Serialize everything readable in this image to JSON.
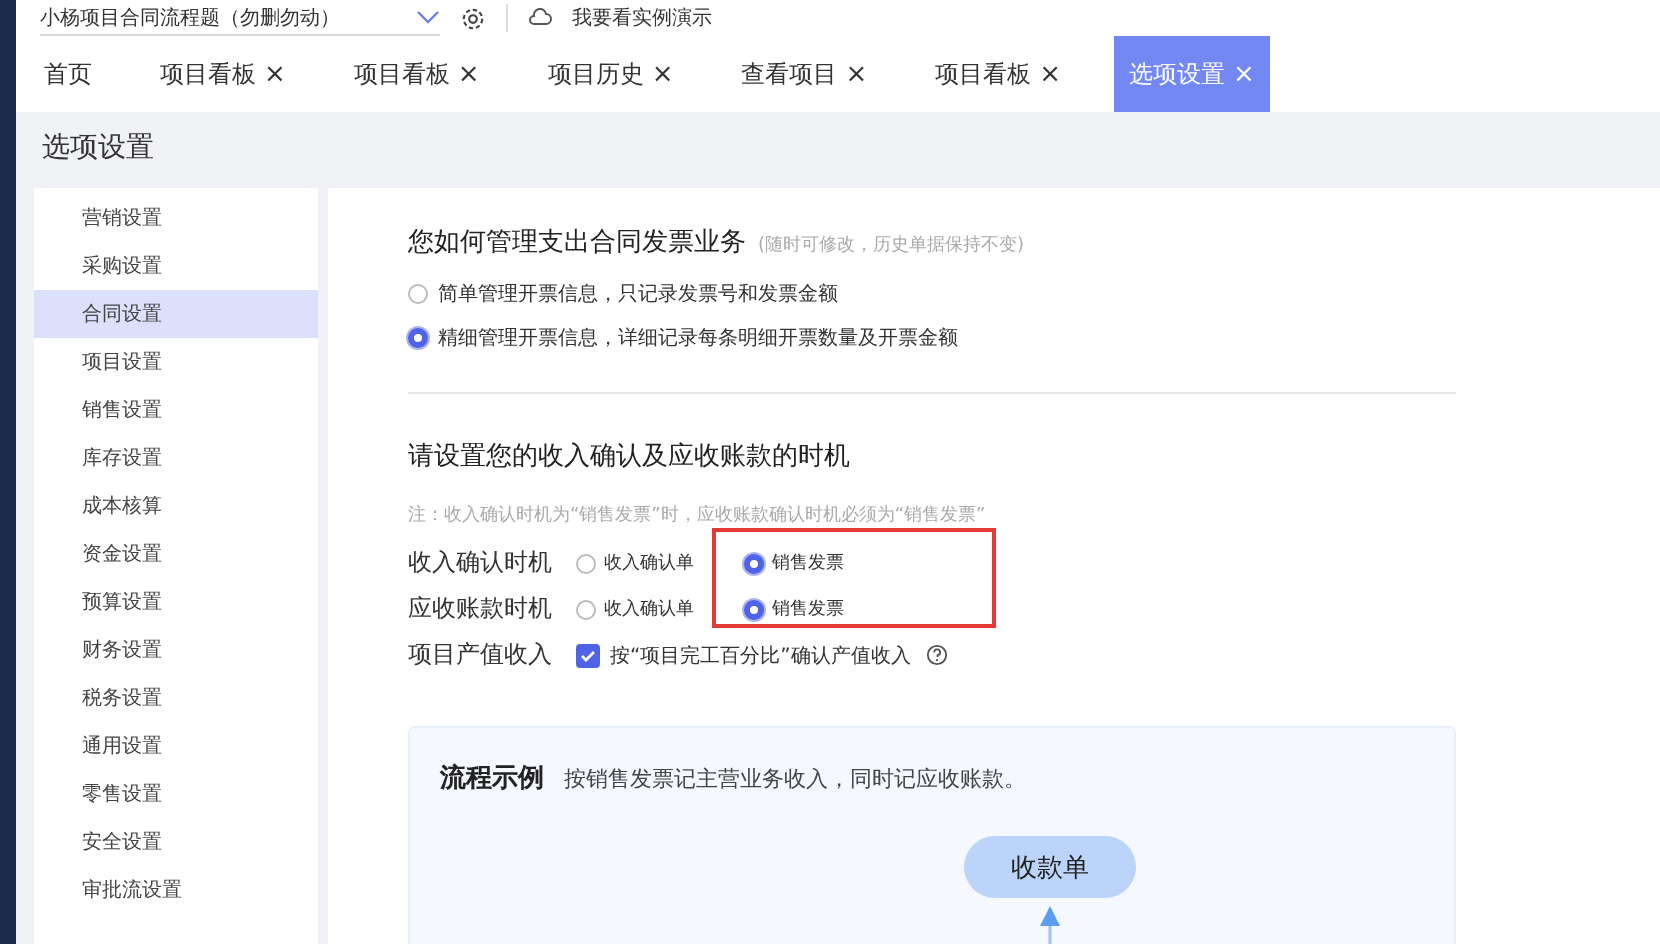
{
  "header": {
    "project": "小杨项目合同流程题（勿删勿动）",
    "demo_link": "我要看实例演示"
  },
  "tabs": [
    {
      "label": "首页",
      "closable": false,
      "selected": false
    },
    {
      "label": "项目看板",
      "closable": true,
      "selected": false
    },
    {
      "label": "项目看板",
      "closable": true,
      "selected": false
    },
    {
      "label": "项目历史",
      "closable": true,
      "selected": false
    },
    {
      "label": "查看项目",
      "closable": true,
      "selected": false
    },
    {
      "label": "项目看板",
      "closable": true,
      "selected": false
    },
    {
      "label": "选项设置",
      "closable": true,
      "selected": true
    }
  ],
  "close_glyph": "×",
  "page_title": "选项设置",
  "sidebar": {
    "items": [
      {
        "label": "营销设置",
        "selected": false
      },
      {
        "label": "采购设置",
        "selected": false
      },
      {
        "label": "合同设置",
        "selected": true
      },
      {
        "label": "项目设置",
        "selected": false
      },
      {
        "label": "销售设置",
        "selected": false
      },
      {
        "label": "库存设置",
        "selected": false
      },
      {
        "label": "成本核算",
        "selected": false
      },
      {
        "label": "资金设置",
        "selected": false
      },
      {
        "label": "预算设置",
        "selected": false
      },
      {
        "label": "财务设置",
        "selected": false
      },
      {
        "label": "税务设置",
        "selected": false
      },
      {
        "label": "通用设置",
        "selected": false
      },
      {
        "label": "零售设置",
        "selected": false
      },
      {
        "label": "安全设置",
        "selected": false
      },
      {
        "label": "审批流设置",
        "selected": false
      }
    ]
  },
  "invoice_section": {
    "title": "您如何管理支出合同发票业务",
    "hint": "(随时可修改，历史单据保持不变)",
    "options": [
      {
        "label": "简单管理开票信息，只记录发票号和发票金额",
        "selected": false
      },
      {
        "label": "精细管理开票信息，详细记录每条明细开票数量及开票金额",
        "selected": true
      }
    ]
  },
  "revenue_section": {
    "title": "请设置您的收入确认及应收账款的时机",
    "note": "注：收入确认时机为“销售发票”时，应收账款确认时机必须为“销售发票”",
    "rows": [
      {
        "kind": "radio",
        "label": "收入确认时机",
        "options": [
          {
            "label": "收入确认单",
            "selected": false
          },
          {
            "label": "销售发票",
            "selected": true
          }
        ]
      },
      {
        "kind": "radio",
        "label": "应收账款时机",
        "options": [
          {
            "label": "收入确认单",
            "selected": false
          },
          {
            "label": "销售发票",
            "selected": true
          }
        ]
      },
      {
        "kind": "checkbox",
        "label": "项目产值收入",
        "text": "按“项目完工百分比”确认产值收入",
        "checked": true
      }
    ]
  },
  "flow_example": {
    "title": "流程示例",
    "description": "按销售发票记主营业务收入，同时记应收账款。",
    "node": "收款单"
  }
}
